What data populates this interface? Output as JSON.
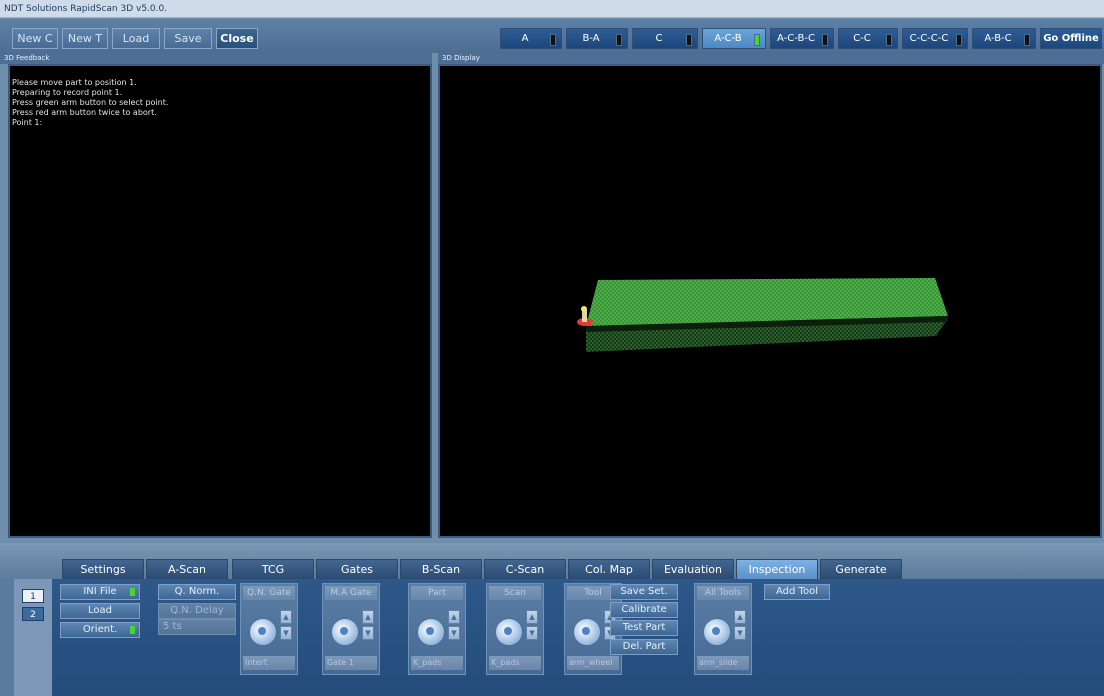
{
  "window": {
    "title": "NDT Solutions RapidScan 3D v5.0.0."
  },
  "toolbar": {
    "new_c": "New C",
    "new_t": "New T",
    "load": "Load",
    "save": "Save",
    "close": "Close"
  },
  "views": [
    {
      "label": "A",
      "on": false
    },
    {
      "label": "B-A",
      "on": false
    },
    {
      "label": "C",
      "on": false
    },
    {
      "label": "A-C-B",
      "on": true
    },
    {
      "label": "A-C-B-C",
      "on": false
    },
    {
      "label": "C-C",
      "on": false
    },
    {
      "label": "C-C-C-C",
      "on": false
    },
    {
      "label": "A-B-C",
      "on": false
    }
  ],
  "go_offline": "Go Offline",
  "feedback": {
    "title": "3D Feedback",
    "lines": [
      "Please move part to position 1.",
      "Preparing to record point 1.",
      "Press green arm button to select point.",
      "Press red arm button twice to abort.",
      "Point 1:"
    ]
  },
  "display": {
    "title": "3D Display"
  },
  "tabs": [
    "Settings",
    "A-Scan",
    "TCG",
    "Gates",
    "B-Scan",
    "C-Scan",
    "Col. Map",
    "Evaluation",
    "Inspection",
    "Generate"
  ],
  "active_tab": "Inspection",
  "side_numbers": [
    "1",
    "2"
  ],
  "inspection": {
    "ini_file": "INI File",
    "load": "Load",
    "orient": "Orient.",
    "q_norm": "Q. Norm.",
    "qn_delay": "Q.N. Delay",
    "qn_delay_value": "5 ts",
    "save_set": "Save Set.",
    "calibrate": "Calibrate",
    "test_part": "Test Part",
    "del_part": "Del. Part",
    "add_tool": "Add Tool",
    "controls": [
      {
        "caption": "Q.N. Gate",
        "value": "Interf."
      },
      {
        "caption": "M.A Gate",
        "value": "Gate 1"
      },
      {
        "caption": "Part",
        "value": "K_pads"
      },
      {
        "caption": "Scan",
        "value": "K_pads"
      },
      {
        "caption": "Tool",
        "value": "arm_wheel"
      },
      {
        "caption": "All Tools",
        "value": "arm_slide"
      }
    ]
  },
  "colors": {
    "accent": "#5a91c8",
    "indicator_on": "#48d436",
    "part_green": "#3d9a3b",
    "probe_red": "#e43a3a"
  }
}
